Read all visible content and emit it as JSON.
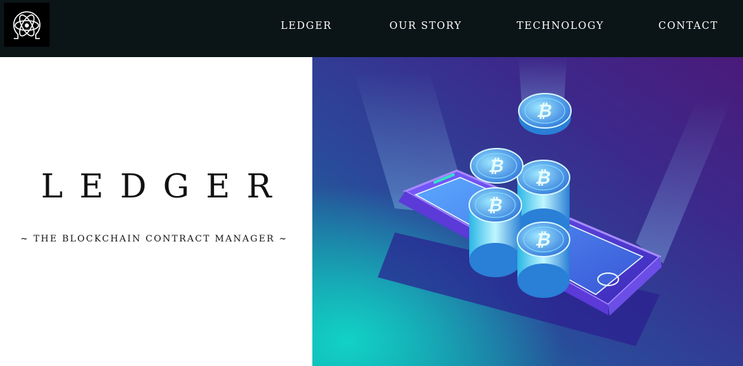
{
  "nav": {
    "logo_icon": "atom-omega-icon",
    "items": [
      {
        "label": "LEDGER"
      },
      {
        "label": "OUR STORY"
      },
      {
        "label": "TECHNOLOGY"
      },
      {
        "label": "CONTACT"
      }
    ]
  },
  "hero": {
    "title": "LEDGER",
    "subtitle": "~ THE BLOCKCHAIN CONTRACT MANAGER ~",
    "illustration_icon": "smartphone-bitcoin-stacks-illustration"
  },
  "colors": {
    "navbar_bg": "#0b1416",
    "hero_purple": "#4a1a7a",
    "hero_teal": "#12c4c0",
    "coin_cyan": "#5fe6ff"
  }
}
